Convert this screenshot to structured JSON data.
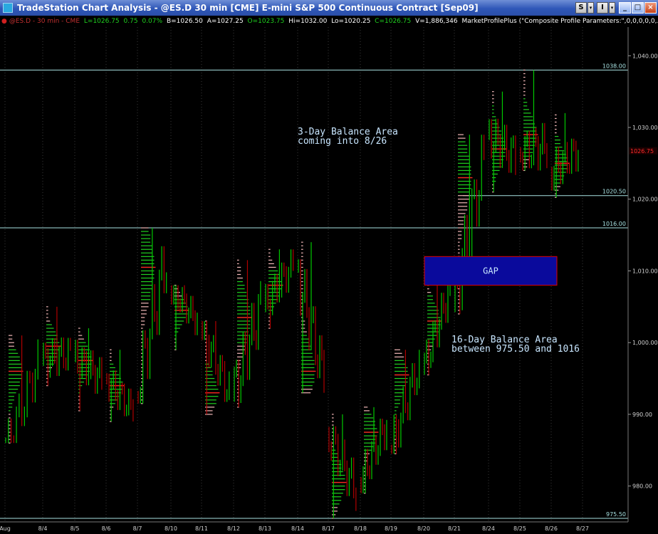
{
  "window": {
    "title": "TradeStation Chart Analysis - @ES.D 30 min [CME] E-mini S&P 500 Continuous Contract [Sep09]",
    "btn_s": "S",
    "btn_i": "I",
    "minimize": "_",
    "maximize": "□",
    "close": "×"
  },
  "status": {
    "symbol": "@ES.D - 30 min - CME",
    "last": "L=1026.75",
    "change": "0.75",
    "pct": "0.07%",
    "bid": "B=1026.50",
    "ask": "A=1027.25",
    "open": "O=1023.75",
    "high": "Hi=1032.00",
    "low": "Lo=1020.25",
    "close": "C=1026.75",
    "volume": "V=1,886,346",
    "indicator": "MarketProfilePlus (\"Composite Profile Parameters:\",0,0,0,0,0,..."
  },
  "colors": {
    "background": "#000000",
    "up_bar": "#00c800",
    "down_bar": "#b00000",
    "profile_tpo": "#f2b8b8",
    "profile_value_area": "#1fd11f",
    "poc": "#ff2020",
    "ref_line": "#a8e2e2",
    "gap_fill": "#0a0a9c",
    "gap_border": "#e00000",
    "annotation": "#c8e6ff",
    "axis_text": "#d0d0d0",
    "price_tag": "#ff2a2a"
  },
  "chart_data": {
    "type": "market-profile",
    "ylim": [
      975,
      1044
    ],
    "y_ticks": [
      {
        "v": 980,
        "label": "980.00"
      },
      {
        "v": 990,
        "label": "990.00"
      },
      {
        "v": 1000,
        "label": "1,000.00"
      },
      {
        "v": 1010,
        "label": "1,010.00"
      },
      {
        "v": 1020,
        "label": "1,020.00"
      },
      {
        "v": 1030,
        "label": "1,030.00"
      },
      {
        "v": 1040,
        "label": "1,040.00"
      }
    ],
    "x_labels": [
      "Aug",
      "8/4",
      "8/5",
      "8/6",
      "8/7",
      "8/10",
      "8/11",
      "8/12",
      "8/13",
      "8/14",
      "8/17",
      "8/18",
      "8/19",
      "8/20",
      "8/21",
      "8/24",
      "8/25",
      "8/26",
      "8/27"
    ],
    "sessions": [
      {
        "date": "8/3",
        "low": 986.0,
        "high": 1001.0,
        "va_low": 990.5,
        "va_high": 999.0,
        "poc": 996.0,
        "open": 984.0,
        "close": 997.0
      },
      {
        "date": "8/4",
        "low": 994.0,
        "high": 1005.0,
        "va_low": 997.0,
        "va_high": 1002.5,
        "poc": 999.5,
        "open": 997.5,
        "close": 998.5
      },
      {
        "date": "8/5",
        "low": 990.5,
        "high": 1002.0,
        "va_low": 993.0,
        "va_high": 1000.0,
        "poc": 997.5,
        "open": 998.0,
        "close": 995.0
      },
      {
        "date": "8/6",
        "low": 989.0,
        "high": 999.0,
        "va_low": 991.5,
        "va_high": 997.0,
        "poc": 994.0,
        "open": 995.0,
        "close": 990.5
      },
      {
        "date": "8/7",
        "low": 991.5,
        "high": 1016.0,
        "va_low": 1006.0,
        "va_high": 1015.5,
        "poc": 1010.5,
        "open": 992.5,
        "close": 1012.0
      },
      {
        "date": "8/10",
        "low": 999.0,
        "high": 1008.0,
        "va_low": 1001.0,
        "va_high": 1006.0,
        "poc": 1004.5,
        "open": 1008.0,
        "close": 1003.0
      },
      {
        "date": "8/11",
        "low": 990.0,
        "high": 1003.0,
        "va_low": 991.5,
        "va_high": 997.0,
        "poc": 993.0,
        "open": 1002.5,
        "close": 993.0
      },
      {
        "date": "8/12",
        "low": 991.0,
        "high": 1011.5,
        "va_low": 1000.0,
        "va_high": 1008.5,
        "poc": 1003.5,
        "open": 992.5,
        "close": 1005.0
      },
      {
        "date": "8/13",
        "low": 1002.0,
        "high": 1013.0,
        "va_low": 1004.0,
        "va_high": 1010.0,
        "poc": 1008.0,
        "open": 1005.0,
        "close": 1011.0
      },
      {
        "date": "8/14",
        "low": 993.0,
        "high": 1014.0,
        "va_low": 994.0,
        "va_high": 1001.0,
        "poc": 996.0,
        "open": 1010.5,
        "close": 995.0
      },
      {
        "date": "8/17",
        "low": 975.5,
        "high": 990.0,
        "va_low": 977.5,
        "va_high": 985.0,
        "poc": 980.5,
        "open": 987.5,
        "close": 979.5
      },
      {
        "date": "8/18",
        "low": 979.0,
        "high": 991.0,
        "va_low": 985.0,
        "va_high": 990.0,
        "poc": 987.5,
        "open": 980.5,
        "close": 988.5
      },
      {
        "date": "8/19",
        "low": 984.5,
        "high": 999.0,
        "va_low": 987.0,
        "va_high": 997.5,
        "poc": 995.5,
        "open": 985.0,
        "close": 997.0
      },
      {
        "date": "8/20",
        "low": 995.5,
        "high": 1008.0,
        "va_low": 1000.0,
        "va_high": 1006.5,
        "poc": 1003.0,
        "open": 996.0,
        "close": 1007.5
      },
      {
        "date": "8/21",
        "low": 1004.0,
        "high": 1029.0,
        "va_low": 1021.0,
        "va_high": 1028.0,
        "poc": 1023.0,
        "open": 1005.0,
        "close": 1025.5
      },
      {
        "date": "8/24",
        "low": 1021.0,
        "high": 1035.0,
        "va_low": 1022.5,
        "va_high": 1033.0,
        "poc": 1027.0,
        "open": 1029.0,
        "close": 1026.0
      },
      {
        "date": "8/25",
        "low": 1024.0,
        "high": 1038.0,
        "va_low": 1026.0,
        "va_high": 1034.0,
        "poc": 1029.0,
        "open": 1026.5,
        "close": 1027.5
      },
      {
        "date": "8/26",
        "low": 1020.25,
        "high": 1032.0,
        "va_low": 1022.0,
        "va_high": 1029.0,
        "poc": 1025.0,
        "open": 1023.75,
        "close": 1026.75
      }
    ],
    "reference_lines": [
      {
        "price": 1038.0,
        "label": "1038.00"
      },
      {
        "price": 1016.0,
        "label": "1016.00"
      },
      {
        "price": 1020.5,
        "label": "1020.50",
        "start_date": "8/21"
      },
      {
        "price": 975.5,
        "label": "975.50"
      }
    ],
    "gap": {
      "low": 1008.0,
      "high": 1012.0,
      "label": "GAP"
    },
    "last_price": "1026.75",
    "annotations": [
      {
        "lines": [
          "3-Day Balance Area",
          "coming into 8/26"
        ],
        "price": 1029.0
      },
      {
        "lines": [
          "16-Day Balance Area",
          "between 975.50 and 1016"
        ],
        "price": 1000.0
      }
    ]
  }
}
